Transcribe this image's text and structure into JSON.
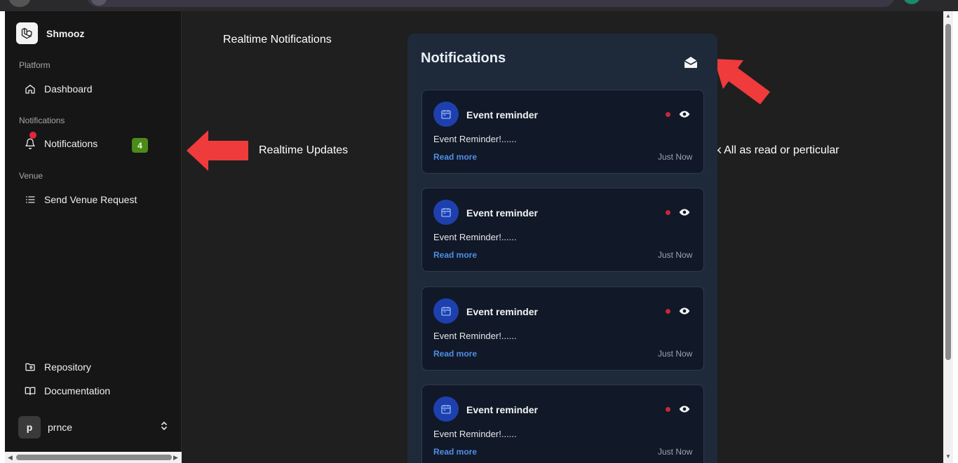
{
  "app": {
    "name": "Shmooz"
  },
  "sidebar": {
    "sections": [
      {
        "label": "Platform"
      },
      {
        "label": "Notifications"
      },
      {
        "label": "Venue"
      }
    ],
    "items": [
      {
        "label": "Dashboard",
        "icon": "home-icon"
      },
      {
        "label": "Notifications",
        "icon": "bell-icon",
        "badge": "4"
      },
      {
        "label": "Send Venue Request",
        "icon": "list-icon"
      }
    ],
    "footer_items": [
      {
        "label": "Repository",
        "icon": "folder-git-icon"
      },
      {
        "label": "Documentation",
        "icon": "book-open-icon"
      }
    ],
    "user": {
      "initial": "p",
      "name": "prnce"
    }
  },
  "annotations": {
    "heading": "Realtime Notifications",
    "updates": "Realtime Updates",
    "mark": "Mark All as read or perticular"
  },
  "panel": {
    "title": "Notifications",
    "mark_all_icon": "envelope-open-icon",
    "cards": [
      {
        "title": "Event reminder",
        "message": "Event Reminder!......",
        "link": "Read more",
        "time": "Just Now"
      },
      {
        "title": "Event reminder",
        "message": "Event Reminder!......",
        "link": "Read more",
        "time": "Just Now"
      },
      {
        "title": "Event reminder",
        "message": "Event Reminder!......",
        "link": "Read more",
        "time": "Just Now"
      },
      {
        "title": "Event reminder",
        "message": "Event Reminder!......",
        "link": "Read more",
        "time": "Just Now"
      }
    ]
  },
  "colors": {
    "accent_arrow": "#ef3b3b",
    "badge": "#4c8a1a",
    "link": "#4f8fe8",
    "unread": "#c5283d",
    "icon_circle": "#1e40af"
  }
}
